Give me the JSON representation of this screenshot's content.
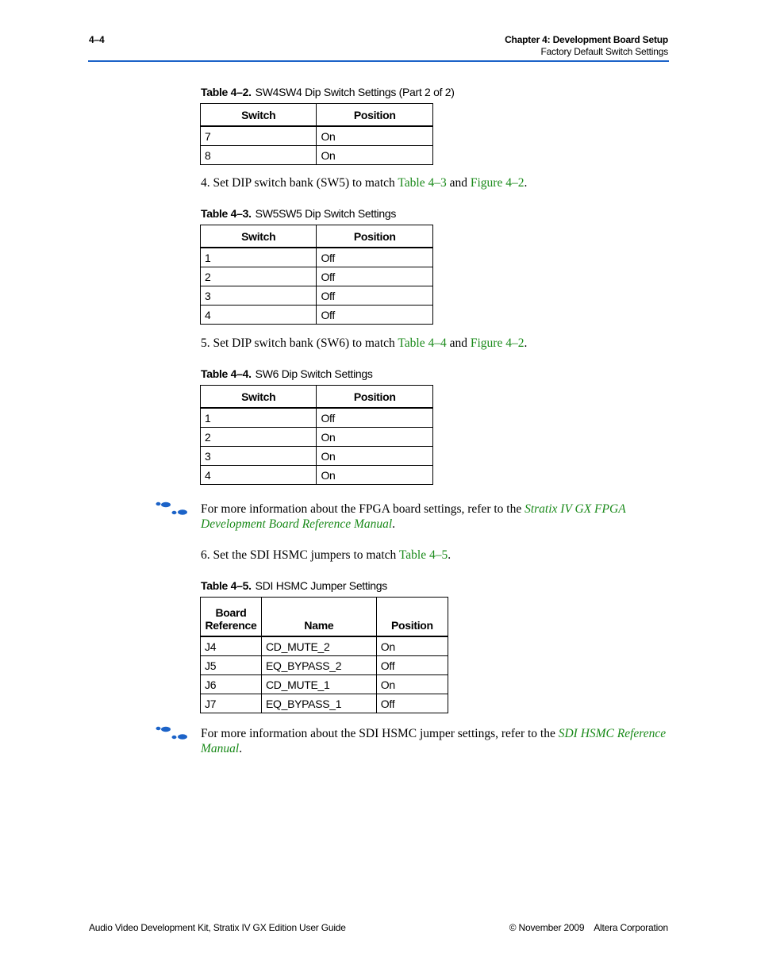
{
  "header": {
    "page_number": "4–4",
    "chapter": "Chapter 4:  Development Board Setup",
    "section": "Factory Default Switch Settings",
    "rule_color": "#1c63c8"
  },
  "table_4_2": {
    "caption_label": "Table 4–2.",
    "caption_text": "SW4SW4 Dip Switch Settings  (Part 2 of 2)",
    "columns": [
      "Switch",
      "Position"
    ],
    "rows": [
      [
        "7",
        "On"
      ],
      [
        "8",
        "On"
      ]
    ]
  },
  "step4": {
    "prefix": "4.  Set DIP switch bank (SW5) to match ",
    "link1": "Table 4–3",
    "mid": " and ",
    "link2": "Figure 4–2",
    "suffix": "."
  },
  "table_4_3": {
    "caption_label": "Table 4–3.",
    "caption_text": "SW5SW5 Dip Switch Settings",
    "columns": [
      "Switch",
      "Position"
    ],
    "rows": [
      [
        "1",
        "Off"
      ],
      [
        "2",
        "Off"
      ],
      [
        "3",
        "Off"
      ],
      [
        "4",
        "Off"
      ]
    ]
  },
  "step5": {
    "prefix": "5.  Set DIP switch bank (SW6) to match ",
    "link1": "Table 4–4",
    "mid": " and ",
    "link2": "Figure 4–2",
    "suffix": "."
  },
  "table_4_4": {
    "caption_label": "Table 4–4.",
    "caption_text": "SW6 Dip Switch Settings",
    "columns": [
      "Switch",
      "Position"
    ],
    "rows": [
      [
        "1",
        "Off"
      ],
      [
        "2",
        "On"
      ],
      [
        "3",
        "On"
      ],
      [
        "4",
        "On"
      ]
    ]
  },
  "note1": {
    "icon": "footprints-icon",
    "text": "For more information about the FPGA board settings, refer to the ",
    "link": "Stratix IV GX FPGA Development Board Reference Manual",
    "suffix": "."
  },
  "step6": {
    "prefix": "6.  Set the SDI HSMC jumpers to match ",
    "link1": "Table 4–5",
    "suffix": "."
  },
  "table_4_5": {
    "caption_label": "Table 4–5.",
    "caption_text": "SDI HSMC Jumper Settings",
    "columns": [
      "Board Reference",
      "Name",
      "Position"
    ],
    "rows": [
      [
        "J4",
        "CD_MUTE_2",
        "On"
      ],
      [
        "J5",
        "EQ_BYPASS_2",
        "Off"
      ],
      [
        "J6",
        "CD_MUTE_1",
        "On"
      ],
      [
        "J7",
        "EQ_BYPASS_1",
        "Off"
      ]
    ]
  },
  "note2": {
    "icon": "footprints-icon",
    "text": "For more information about the SDI HSMC jumper settings, refer to the ",
    "link": "SDI HSMC Reference Manual",
    "suffix": "."
  },
  "footer": {
    "left": "Audio Video Development Kit, Stratix IV GX Edition User Guide",
    "right": "© November 2009    Altera Corporation"
  },
  "colors": {
    "link": "#1a8a1a",
    "icon": "#1c63c8"
  }
}
